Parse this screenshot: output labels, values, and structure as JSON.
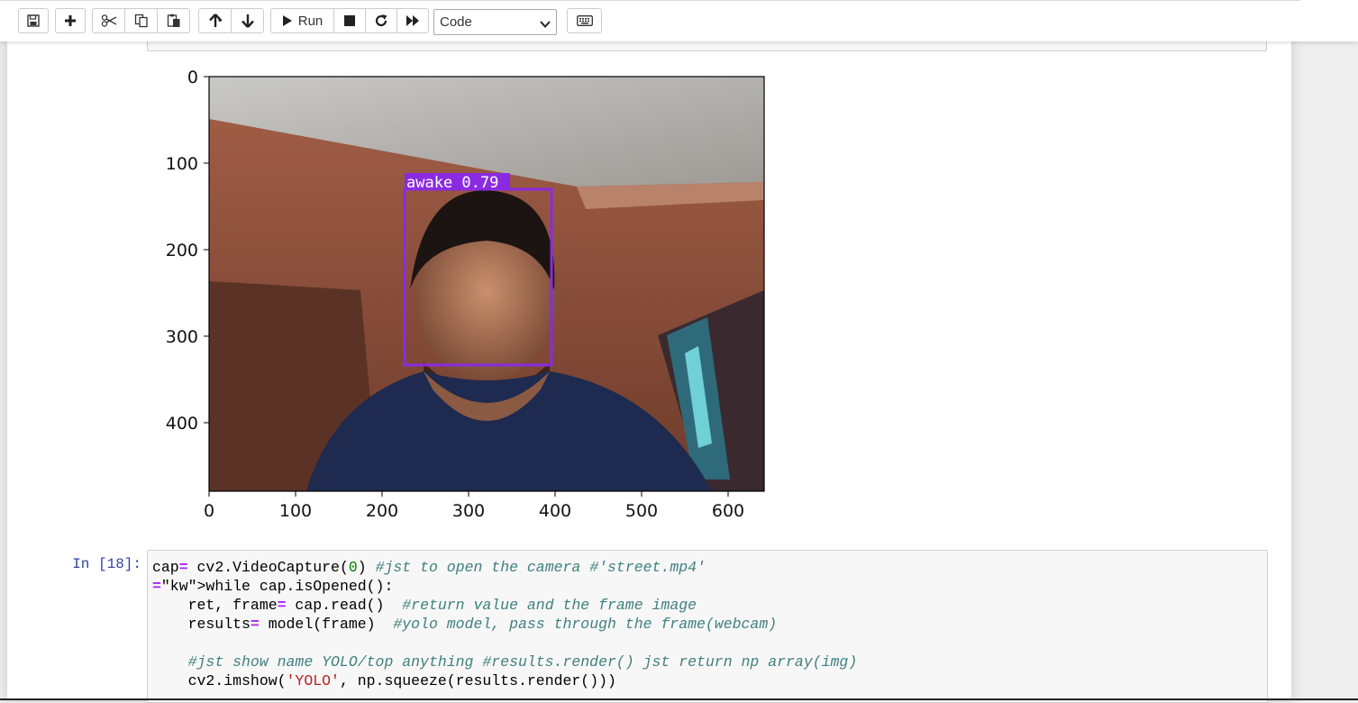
{
  "toolbar": {
    "run_label": "Run",
    "cell_type_selected": "Code",
    "icons": [
      "save-icon",
      "plus-icon",
      "cut-icon",
      "copy-icon",
      "paste-icon",
      "arrow-up-icon",
      "arrow-down-icon",
      "play-icon",
      "stop-icon",
      "restart-icon",
      "fast-forward-icon",
      "keyboard-icon"
    ]
  },
  "output_figure": {
    "y_ticks": [
      "0",
      "100",
      "200",
      "300",
      "400"
    ],
    "x_ticks": [
      "0",
      "100",
      "200",
      "300",
      "400",
      "500",
      "600"
    ],
    "detection_label": "awake 0.79",
    "box_color": "#8a2be2"
  },
  "code_cell": {
    "prompt": "In [18]:",
    "lines": [
      "cap= cv2.VideoCapture(0) #jst to open the camera #'street.mp4'",
      "while cap.isOpened():",
      "    ret, frame= cap.read()  #return value and the frame image",
      "    results= model(frame)  #yolo model, pass through the frame(webcam)",
      "",
      "    #jst show name YOLO/top anything #results.render() jst return np array(img)",
      "    cv2.imshow('YOLO', np.squeeze(results.render()))"
    ]
  }
}
